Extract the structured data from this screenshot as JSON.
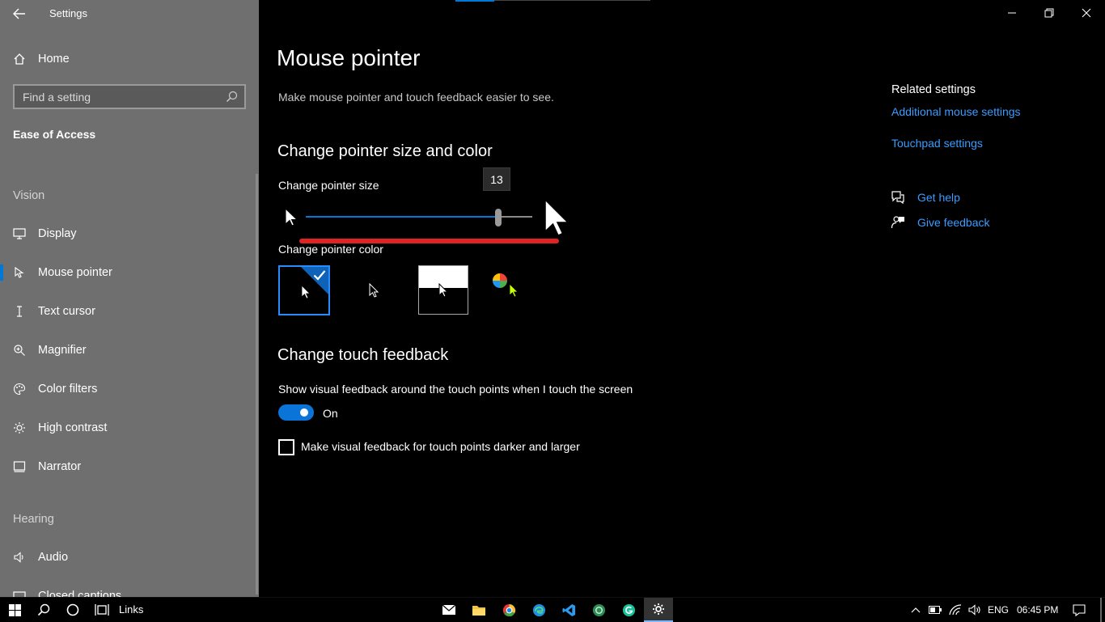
{
  "window": {
    "title": "Settings"
  },
  "sidebar": {
    "home": "Home",
    "search_placeholder": "Find a setting",
    "section": "Ease of Access",
    "vision_header": "Vision",
    "items": [
      {
        "label": "Display",
        "icon": "monitor-icon"
      },
      {
        "label": "Mouse pointer",
        "icon": "mouse-pointer-icon",
        "selected": true
      },
      {
        "label": "Text cursor",
        "icon": "text-cursor-icon"
      },
      {
        "label": "Magnifier",
        "icon": "magnifier-icon"
      },
      {
        "label": "Color filters",
        "icon": "color-filters-icon"
      },
      {
        "label": "High contrast",
        "icon": "high-contrast-icon"
      },
      {
        "label": "Narrator",
        "icon": "narrator-icon"
      }
    ],
    "hearing_header": "Hearing",
    "hearing_items": [
      {
        "label": "Audio",
        "icon": "audio-icon"
      },
      {
        "label": "Closed captions",
        "icon": "closed-captions-icon"
      }
    ]
  },
  "main": {
    "title": "Mouse pointer",
    "description": "Make mouse pointer and touch feedback easier to see.",
    "size_color_heading": "Change pointer size and color",
    "size_label": "Change pointer size",
    "size_value": "13",
    "size_fraction": 0.85,
    "color_label": "Change pointer color",
    "color_options": [
      "white",
      "black",
      "inverted",
      "custom"
    ],
    "selected_color": "white",
    "touch_heading": "Change touch feedback",
    "touch_label": "Show visual feedback around the touch points when I touch the screen",
    "toggle_state": "On",
    "checkbox_label": "Make visual feedback for touch points darker and larger"
  },
  "related": {
    "heading": "Related settings",
    "additional_mouse": "Additional mouse settings",
    "touchpad": "Touchpad settings",
    "get_help": "Get help",
    "give_feedback": "Give feedback"
  },
  "taskbar": {
    "links_label": "Links",
    "language": "ENG",
    "time": "06:45 PM"
  },
  "colors": {
    "accent": "#0078d7",
    "link": "#3a9cff",
    "sidebar": "#6f6f6f",
    "underline": "#e02424"
  }
}
